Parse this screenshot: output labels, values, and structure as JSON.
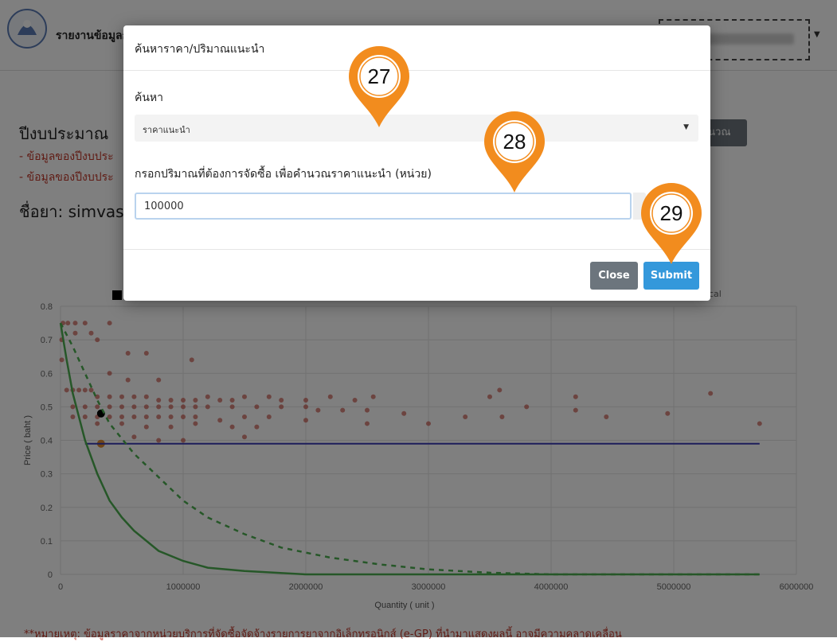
{
  "header": {
    "title": "รายงานข้อมูลก"
  },
  "page": {
    "year_title": "ปีงบประมาณ",
    "note_1": "- ข้อมูลของปีงบประ",
    "note_2": "- ข้อมูลของปีงบประ",
    "drug_label": "ชื่อยา: simvas",
    "calc_button": "านวณ",
    "legend_tail": "cal",
    "footer_note": "**หมายเหตุ: ข้อมูลราคาจากหน่วยบริการที่จัดซื้อจัดจ้างรายการยาจากอิเล็กทรอนิกส์ (e-GP) ที่นำมาแสดงผลนี้ อาจมีความคลาดเคลื่อน"
  },
  "modal": {
    "title": "ค้นหาราคา/ปริมาณแนะนำ",
    "search_label": "ค้นหา",
    "search_option": "ราคาแนะนำ",
    "quantity_label": "กรอกปริมาณที่ต้องการจัดซื้อ เพื่อคำนวณราคาแนะนำ (หน่วย)",
    "quantity_value": "100000",
    "close_label": "Close",
    "submit_label": "Submit"
  },
  "markers": [
    "27",
    "28",
    "29"
  ],
  "colors": {
    "marker": "#f28c1e",
    "submit": "#3498db",
    "close": "#6c757d",
    "note_red": "#c0392b"
  },
  "chart_data": {
    "type": "scatter",
    "xlabel": "Quantity ( unit )",
    "ylabel": "Price ( baht )",
    "xlim": [
      0,
      6000000
    ],
    "ylim": [
      0,
      0.8
    ],
    "xticks": [
      0,
      1000000,
      2000000,
      3000000,
      4000000,
      5000000,
      6000000
    ],
    "yticks": [
      0,
      0.1,
      0.2,
      0.3,
      0.4,
      0.5,
      0.6,
      0.7,
      0.8
    ],
    "grid": true,
    "series": [
      {
        "kind": "scatter",
        "color": "#c0392b",
        "points": [
          [
            20000,
            0.75
          ],
          [
            60000,
            0.75
          ],
          [
            120000,
            0.75
          ],
          [
            200000,
            0.75
          ],
          [
            400000,
            0.75
          ],
          [
            120000,
            0.72
          ],
          [
            250000,
            0.72
          ],
          [
            10000,
            0.7
          ],
          [
            300000,
            0.7
          ],
          [
            10000,
            0.64
          ],
          [
            550000,
            0.66
          ],
          [
            700000,
            0.66
          ],
          [
            1070000,
            0.64
          ],
          [
            400000,
            0.6
          ],
          [
            550000,
            0.58
          ],
          [
            800000,
            0.58
          ],
          [
            50000,
            0.55
          ],
          [
            100000,
            0.55
          ],
          [
            150000,
            0.55
          ],
          [
            200000,
            0.55
          ],
          [
            250000,
            0.55
          ],
          [
            300000,
            0.53
          ],
          [
            400000,
            0.53
          ],
          [
            500000,
            0.53
          ],
          [
            600000,
            0.53
          ],
          [
            700000,
            0.53
          ],
          [
            800000,
            0.52
          ],
          [
            900000,
            0.52
          ],
          [
            1000000,
            0.52
          ],
          [
            1100000,
            0.52
          ],
          [
            1200000,
            0.53
          ],
          [
            1300000,
            0.52
          ],
          [
            1400000,
            0.52
          ],
          [
            1500000,
            0.53
          ],
          [
            1700000,
            0.53
          ],
          [
            1800000,
            0.52
          ],
          [
            2000000,
            0.52
          ],
          [
            2200000,
            0.53
          ],
          [
            2400000,
            0.52
          ],
          [
            2550000,
            0.53
          ],
          [
            3500000,
            0.53
          ],
          [
            3580000,
            0.55
          ],
          [
            4200000,
            0.53
          ],
          [
            5300000,
            0.54
          ],
          [
            100000,
            0.5
          ],
          [
            200000,
            0.5
          ],
          [
            300000,
            0.5
          ],
          [
            400000,
            0.5
          ],
          [
            500000,
            0.5
          ],
          [
            600000,
            0.5
          ],
          [
            700000,
            0.5
          ],
          [
            800000,
            0.5
          ],
          [
            900000,
            0.5
          ],
          [
            1000000,
            0.5
          ],
          [
            1100000,
            0.5
          ],
          [
            1200000,
            0.5
          ],
          [
            1400000,
            0.5
          ],
          [
            1600000,
            0.5
          ],
          [
            1800000,
            0.5
          ],
          [
            2000000,
            0.5
          ],
          [
            2100000,
            0.49
          ],
          [
            2300000,
            0.49
          ],
          [
            2500000,
            0.49
          ],
          [
            2800000,
            0.48
          ],
          [
            3000000,
            0.45
          ],
          [
            3300000,
            0.47
          ],
          [
            3600000,
            0.47
          ],
          [
            3800000,
            0.5
          ],
          [
            4200000,
            0.49
          ],
          [
            4450000,
            0.47
          ],
          [
            4950000,
            0.48
          ],
          [
            5700000,
            0.45
          ],
          [
            100000,
            0.47
          ],
          [
            200000,
            0.47
          ],
          [
            300000,
            0.47
          ],
          [
            400000,
            0.47
          ],
          [
            500000,
            0.47
          ],
          [
            600000,
            0.47
          ],
          [
            700000,
            0.47
          ],
          [
            800000,
            0.47
          ],
          [
            900000,
            0.47
          ],
          [
            1000000,
            0.47
          ],
          [
            1100000,
            0.47
          ],
          [
            1300000,
            0.46
          ],
          [
            1500000,
            0.47
          ],
          [
            1700000,
            0.47
          ],
          [
            2000000,
            0.46
          ],
          [
            2500000,
            0.45
          ],
          [
            300000,
            0.45
          ],
          [
            500000,
            0.45
          ],
          [
            700000,
            0.44
          ],
          [
            900000,
            0.44
          ],
          [
            1100000,
            0.45
          ],
          [
            1400000,
            0.44
          ],
          [
            1600000,
            0.44
          ],
          [
            1000000,
            0.4
          ],
          [
            800000,
            0.4
          ],
          [
            600000,
            0.41
          ],
          [
            1500000,
            0.41
          ]
        ]
      },
      {
        "kind": "scatter",
        "color": "#000000",
        "points": [
          [
            330000,
            0.48
          ]
        ]
      },
      {
        "kind": "scatter",
        "color": "#e08a2e",
        "points": [
          [
            330000,
            0.39
          ]
        ]
      },
      {
        "kind": "line",
        "color": "#3a3ab5",
        "points": [
          [
            200000,
            0.39
          ],
          [
            5700000,
            0.39
          ]
        ]
      },
      {
        "kind": "line",
        "color": "#4caf50",
        "dashed": false,
        "points": [
          [
            0,
            0.75
          ],
          [
            50000,
            0.64
          ],
          [
            100000,
            0.54
          ],
          [
            200000,
            0.4
          ],
          [
            300000,
            0.3
          ],
          [
            400000,
            0.22
          ],
          [
            500000,
            0.17
          ],
          [
            600000,
            0.13
          ],
          [
            800000,
            0.07
          ],
          [
            1000000,
            0.04
          ],
          [
            1200000,
            0.02
          ],
          [
            1500000,
            0.01
          ],
          [
            2000000,
            0
          ],
          [
            5700000,
            0
          ]
        ]
      },
      {
        "kind": "line",
        "color": "#4caf50",
        "dashed": true,
        "points": [
          [
            0,
            0.75
          ],
          [
            100000,
            0.68
          ],
          [
            200000,
            0.6
          ],
          [
            300000,
            0.52
          ],
          [
            400000,
            0.45
          ],
          [
            600000,
            0.36
          ],
          [
            800000,
            0.29
          ],
          [
            1000000,
            0.22
          ],
          [
            1200000,
            0.17
          ],
          [
            1500000,
            0.12
          ],
          [
            1800000,
            0.08
          ],
          [
            2200000,
            0.05
          ],
          [
            2600000,
            0.03
          ],
          [
            3000000,
            0.015
          ],
          [
            3500000,
            0.005
          ],
          [
            4000000,
            0
          ],
          [
            5700000,
            0
          ]
        ]
      }
    ]
  }
}
